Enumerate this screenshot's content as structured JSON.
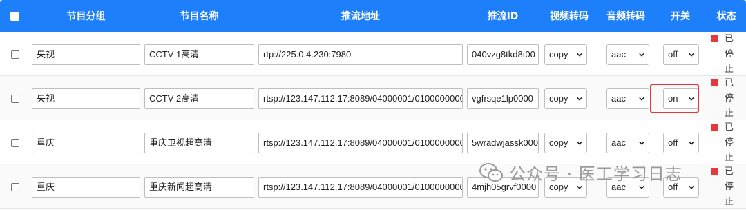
{
  "header": {
    "group": "节目分组",
    "name": "节目名称",
    "url": "推流地址",
    "stream_id": "推流ID",
    "video": "视频转码",
    "audio": "音频转码",
    "switch": "开关",
    "status": "状态"
  },
  "rows": [
    {
      "group": "央视",
      "name": "CCTV-1高清",
      "url": "rtp://225.0.4.230:7980",
      "stream_id": "040vzg8tkd8t00",
      "video": "copy",
      "audio": "aac",
      "switch": "off",
      "status": "已停止"
    },
    {
      "group": "央视",
      "name": "CCTV-2高清",
      "url": "rtsp://123.147.112.17:8089/04000001/0100000000",
      "stream_id": "vgfrsqe1lp0000",
      "video": "copy",
      "audio": "aac",
      "switch": "on",
      "status": "已停止"
    },
    {
      "group": "重庆",
      "name": "重庆卫视超高清",
      "url": "rtsp://123.147.112.17:8089/04000001/0100000000",
      "stream_id": "5wradwjassk000",
      "video": "copy",
      "audio": "aac",
      "switch": "off",
      "status": "已停止"
    },
    {
      "group": "重庆",
      "name": "重庆新闻超高清",
      "url": "rtsp://123.147.112.17:8089/04000001/0100000000",
      "stream_id": "4mjh05grvf0000",
      "video": "copy",
      "audio": "aac",
      "switch": "off",
      "status": "已停止"
    }
  ],
  "watermark": "公众号 · 医工学习日志",
  "colors": {
    "header_bg": "#1e7ffb",
    "status_stopped": "#e8383d",
    "highlight": "#e53935"
  }
}
